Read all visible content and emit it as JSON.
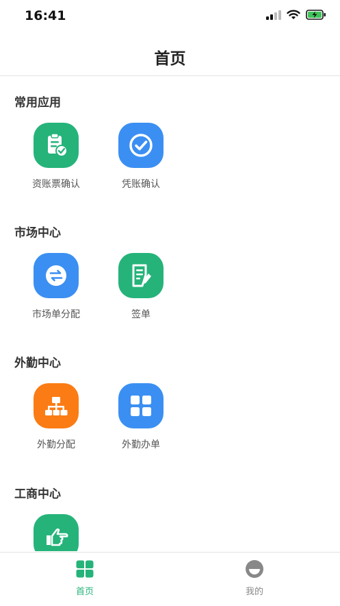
{
  "status_bar": {
    "time": "16:41"
  },
  "nav": {
    "title": "首页"
  },
  "sections": [
    {
      "title": "常用应用",
      "apps": [
        {
          "label": "资账票确认",
          "icon": "clipboard-check-icon",
          "color": "#25b37a"
        },
        {
          "label": "凭账确认",
          "icon": "check-circle-icon",
          "color": "#3b8ff2"
        }
      ]
    },
    {
      "title": "市场中心",
      "apps": [
        {
          "label": "市场单分配",
          "icon": "swap-arrows-icon",
          "color": "#3b8ff2"
        },
        {
          "label": "签单",
          "icon": "document-pen-icon",
          "color": "#25b37a"
        }
      ]
    },
    {
      "title": "外勤中心",
      "apps": [
        {
          "label": "外勤分配",
          "icon": "org-chart-icon",
          "color": "#fb7c14"
        },
        {
          "label": "外勤办单",
          "icon": "grid-icon",
          "color": "#3b8ff2"
        }
      ]
    },
    {
      "title": "工商中心",
      "apps": [
        {
          "label": "",
          "icon": "pointing-hand-icon",
          "color": "#25b37a"
        }
      ]
    }
  ],
  "tabbar": {
    "tabs": [
      {
        "label": "首页",
        "icon": "clover-icon",
        "active": true,
        "color": "#25b37a"
      },
      {
        "label": "我的",
        "icon": "profile-icon",
        "active": false,
        "color": "#888888"
      }
    ]
  }
}
